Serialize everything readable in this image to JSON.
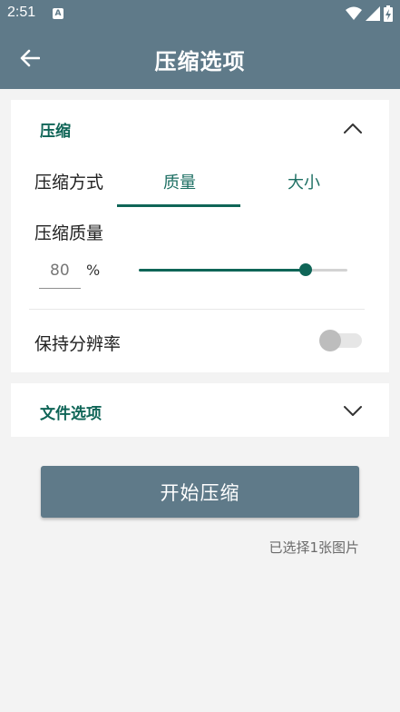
{
  "status_bar": {
    "time": "2:51",
    "notification_icon": "A"
  },
  "app_bar": {
    "title": "压缩选项",
    "back_icon": "arrow-left-icon"
  },
  "compression_card": {
    "section_title": "压缩",
    "expanded": true,
    "method_label": "压缩方式",
    "tabs": [
      {
        "label": "质量",
        "selected": true
      },
      {
        "label": "大小",
        "selected": false
      }
    ],
    "quality_label": "压缩质量",
    "quality_value": "80",
    "quality_unit": "%",
    "quality_slider_fraction": 0.8,
    "keep_resolution_label": "保持分辨率",
    "keep_resolution_enabled": false
  },
  "file_card": {
    "section_title": "文件选项",
    "expanded": false
  },
  "actions": {
    "start_label": "开始压缩",
    "selection_status": "已选择1张图片"
  },
  "colors": {
    "primary": "#5f7a89",
    "accent": "#0f6557"
  }
}
